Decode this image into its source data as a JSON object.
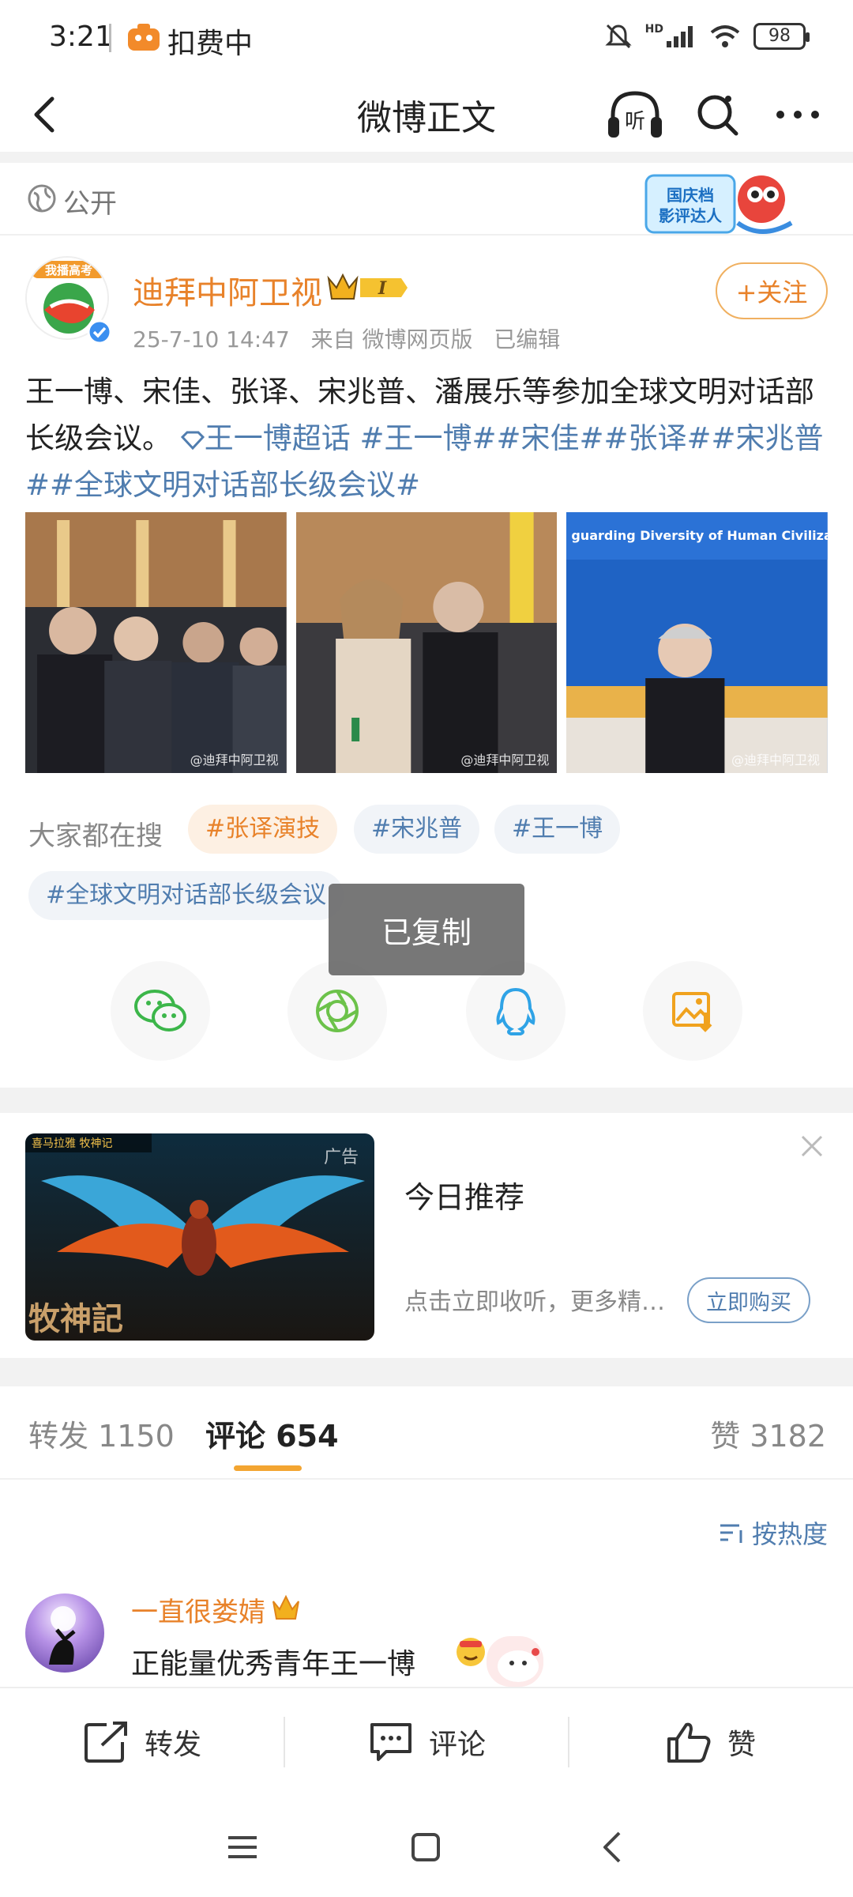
{
  "status_bar": {
    "time": "3:21",
    "app_label": "扣费中",
    "network_label": "HD",
    "battery": "98"
  },
  "nav": {
    "title": "微博正文",
    "listen_label": "听"
  },
  "visibility": {
    "label": "公开",
    "event_badge": "国庆档影评达人"
  },
  "author": {
    "avatar_text": "我播高考",
    "name": "迪拜中阿卫视",
    "vip_level": "I",
    "timestamp": "25-7-10 14:47",
    "source": "来自 微博网页版",
    "edited": "已编辑",
    "follow_label": "+关注"
  },
  "post": {
    "text_plain": "王一博、宋佳、张译、宋兆普、潘展乐等参加全球文明对话部长级会议。",
    "super_topic": "王一博超话",
    "tags": "#王一博##宋佳##张译##宋兆普##全球文明对话部长级会议#",
    "photo_watermark": "@迪拜中阿卫视",
    "photo3_banner": "guarding Diversity of Human Civilizations"
  },
  "hot_search": {
    "label": "大家都在搜",
    "chips": [
      "#张译演技",
      "#宋兆普",
      "#王一博",
      "#全球文明对话部长级会议"
    ]
  },
  "toast": "已复制",
  "share": {
    "icons": [
      "wechat-icon",
      "moments-icon",
      "qq-icon",
      "save-image-icon"
    ]
  },
  "ad": {
    "tag": "广告",
    "image_title": "牧神記",
    "image_corner": "喜马拉雅  牧神记",
    "title": "今日推荐",
    "desc": "点击立即收听，更多精彩内容",
    "buy_label": "立即购买"
  },
  "tabs": {
    "repost": "转发 1150",
    "comment": "评论 654",
    "like": "赞 3182"
  },
  "sort": {
    "label": "按热度"
  },
  "comments": [
    {
      "name": "一直很娄婧",
      "text": "正能量优秀青年王一博"
    }
  ],
  "actions": {
    "repost": "转发",
    "comment": "评论",
    "like": "赞"
  },
  "colors": {
    "accent_orange": "#e8822a",
    "link_blue": "#507daf",
    "indicator": "#f3a531"
  }
}
